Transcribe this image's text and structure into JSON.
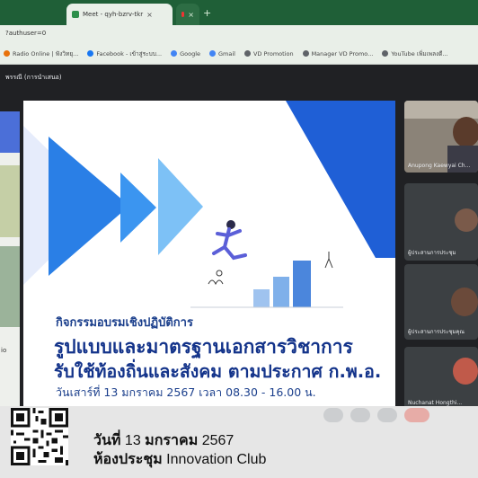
{
  "browser": {
    "tabs": [
      {
        "label": "Meet - qyh-bzrv-tkr",
        "close": "×"
      },
      {
        "label": "",
        "close": "×"
      }
    ],
    "newtab": "+",
    "url": "?authuser=0"
  },
  "bookmarks": [
    {
      "label": "Radio Online | ฟังวิทยุ...",
      "color": "#e8710a"
    },
    {
      "label": "Facebook - เข้าสู่ระบบ...",
      "color": "#1877f2"
    },
    {
      "label": "Google",
      "color": "#4285f4"
    },
    {
      "label": "Gmail",
      "color": "#4285f4"
    },
    {
      "label": "VD Promotion",
      "color": "#5f6368"
    },
    {
      "label": "Manager VD Promo...",
      "color": "#5f6368"
    },
    {
      "label": "YouTube เพิ่มเพลงตี...",
      "color": "#5f6368"
    }
  ],
  "meet": {
    "title": "พรรณี (การนำเสนอ)"
  },
  "slide": {
    "activity": "กิจกรรมอบรมเชิงปฏิบัติการ",
    "title": "รูปแบบและมาตรฐานเอกสารวิชาการ",
    "subtitle": "รับใช้ท้องถิ่นและสังคม ตามประกาศ ก.พ.อ.",
    "date": "วันเสาร์ที่ 13 มกราคม 2567 เวลา 08.30 - 16.00 น.",
    "accent": "#1f5fd6",
    "text_color": "#13338a"
  },
  "left_partial": {
    "text": "io"
  },
  "participants": [
    {
      "name": "Anupong Kaewyai Ch..."
    },
    {
      "name": "ผู้ประสานการประชุม"
    },
    {
      "name": "ผู้ประสานการประชุมคุณ"
    },
    {
      "name": "Nuchanat Hongthi..."
    }
  ],
  "caption": {
    "line1_bold_a": "วันที่",
    "line1_a": "13",
    "line1_bold_b": "มกราคม",
    "line1_b": "2567",
    "line2_bold": "ห้องประชุม",
    "line2": "Innovation Club"
  }
}
